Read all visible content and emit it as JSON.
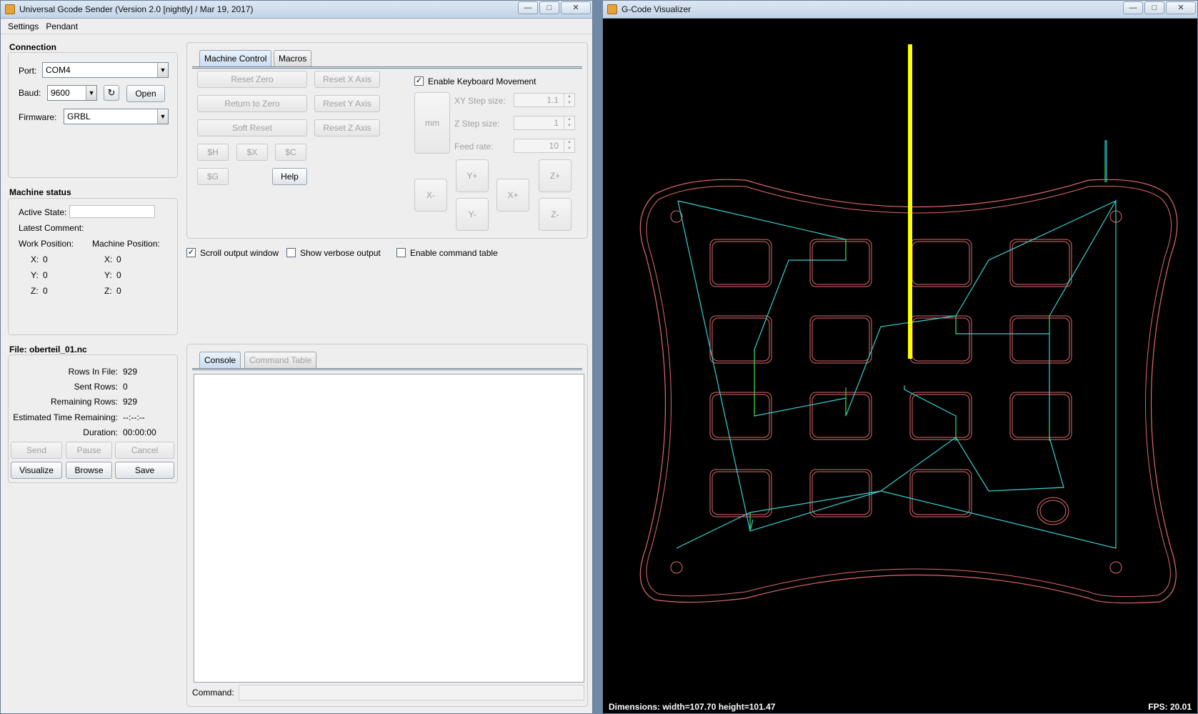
{
  "ugs": {
    "title": "Universal Gcode Sender (Version 2.0 [nightly]  / Mar 19, 2017)",
    "menu": [
      "Settings",
      "Pendant"
    ],
    "connection": {
      "title": "Connection",
      "port_label": "Port:",
      "port_value": "COM4",
      "baud_label": "Baud:",
      "baud_value": "9600",
      "open_label": "Open",
      "firmware_label": "Firmware:",
      "firmware_value": "GRBL"
    },
    "machine_status": {
      "title": "Machine status",
      "active_state_label": "Active State:",
      "active_state_value": "",
      "latest_comment_label": "Latest Comment:",
      "work_position_label": "Work Position:",
      "machine_position_label": "Machine Position:",
      "work": {
        "x_label": "X:",
        "x": "0",
        "y_label": "Y:",
        "y": "0",
        "z_label": "Z:",
        "z": "0"
      },
      "machine": {
        "x_label": "X:",
        "x": "0",
        "y_label": "Y:",
        "y": "0",
        "z_label": "Z:",
        "z": "0"
      }
    },
    "file": {
      "title": "File: oberteil_01.nc",
      "rows_in_file_label": "Rows In File:",
      "rows_in_file": "929",
      "sent_rows_label": "Sent Rows:",
      "sent_rows": "0",
      "remaining_rows_label": "Remaining Rows:",
      "remaining_rows": "929",
      "est_time_label": "Estimated Time Remaining:",
      "est_time": "--:--:--",
      "duration_label": "Duration:",
      "duration": "00:00:00",
      "buttons": {
        "send": "Send",
        "pause": "Pause",
        "cancel": "Cancel",
        "visualize": "Visualize",
        "browse": "Browse",
        "save": "Save"
      }
    },
    "control_tabs": {
      "machine_control": "Machine Control",
      "macros": "Macros"
    },
    "machine_control": {
      "reset_zero": "Reset Zero",
      "return_to_zero": "Return to Zero",
      "soft_reset": "Soft Reset",
      "reset_x": "Reset X Axis",
      "reset_y": "Reset Y Axis",
      "reset_z": "Reset Z Axis",
      "cmd_h": "$H",
      "cmd_x": "$X",
      "cmd_c": "$C",
      "cmd_g": "$G",
      "help": "Help",
      "keyboard_movement_label": "Enable Keyboard Movement",
      "keyboard_movement_checked": true,
      "unit_button": "mm",
      "xy_step_label": "XY Step size:",
      "xy_step": "1.1",
      "z_step_label": "Z Step size:",
      "z_step": "1",
      "feed_rate_label": "Feed rate:",
      "feed_rate": "10",
      "jog": {
        "y_plus": "Y+",
        "y_minus": "Y-",
        "x_minus": "X-",
        "x_plus": "X+",
        "z_plus": "Z+",
        "z_minus": "Z-"
      }
    },
    "options": {
      "scroll_output_label": "Scroll output window",
      "scroll_output_checked": true,
      "verbose_label": "Show verbose output",
      "command_table_label": "Enable command table"
    },
    "console_tabs": {
      "console": "Console",
      "command_table": "Command Table"
    },
    "command_label": "Command:"
  },
  "visualizer": {
    "title": "G-Code Visualizer",
    "dimensions": "Dimensions: width=107.70 height=101.47",
    "fps": "FPS: 20.01",
    "colors": {
      "outline": "#e06b6b",
      "path": "#39d0d0",
      "plunge": "#2ecc40",
      "tool": "#ffff00",
      "background": "#000000"
    }
  }
}
